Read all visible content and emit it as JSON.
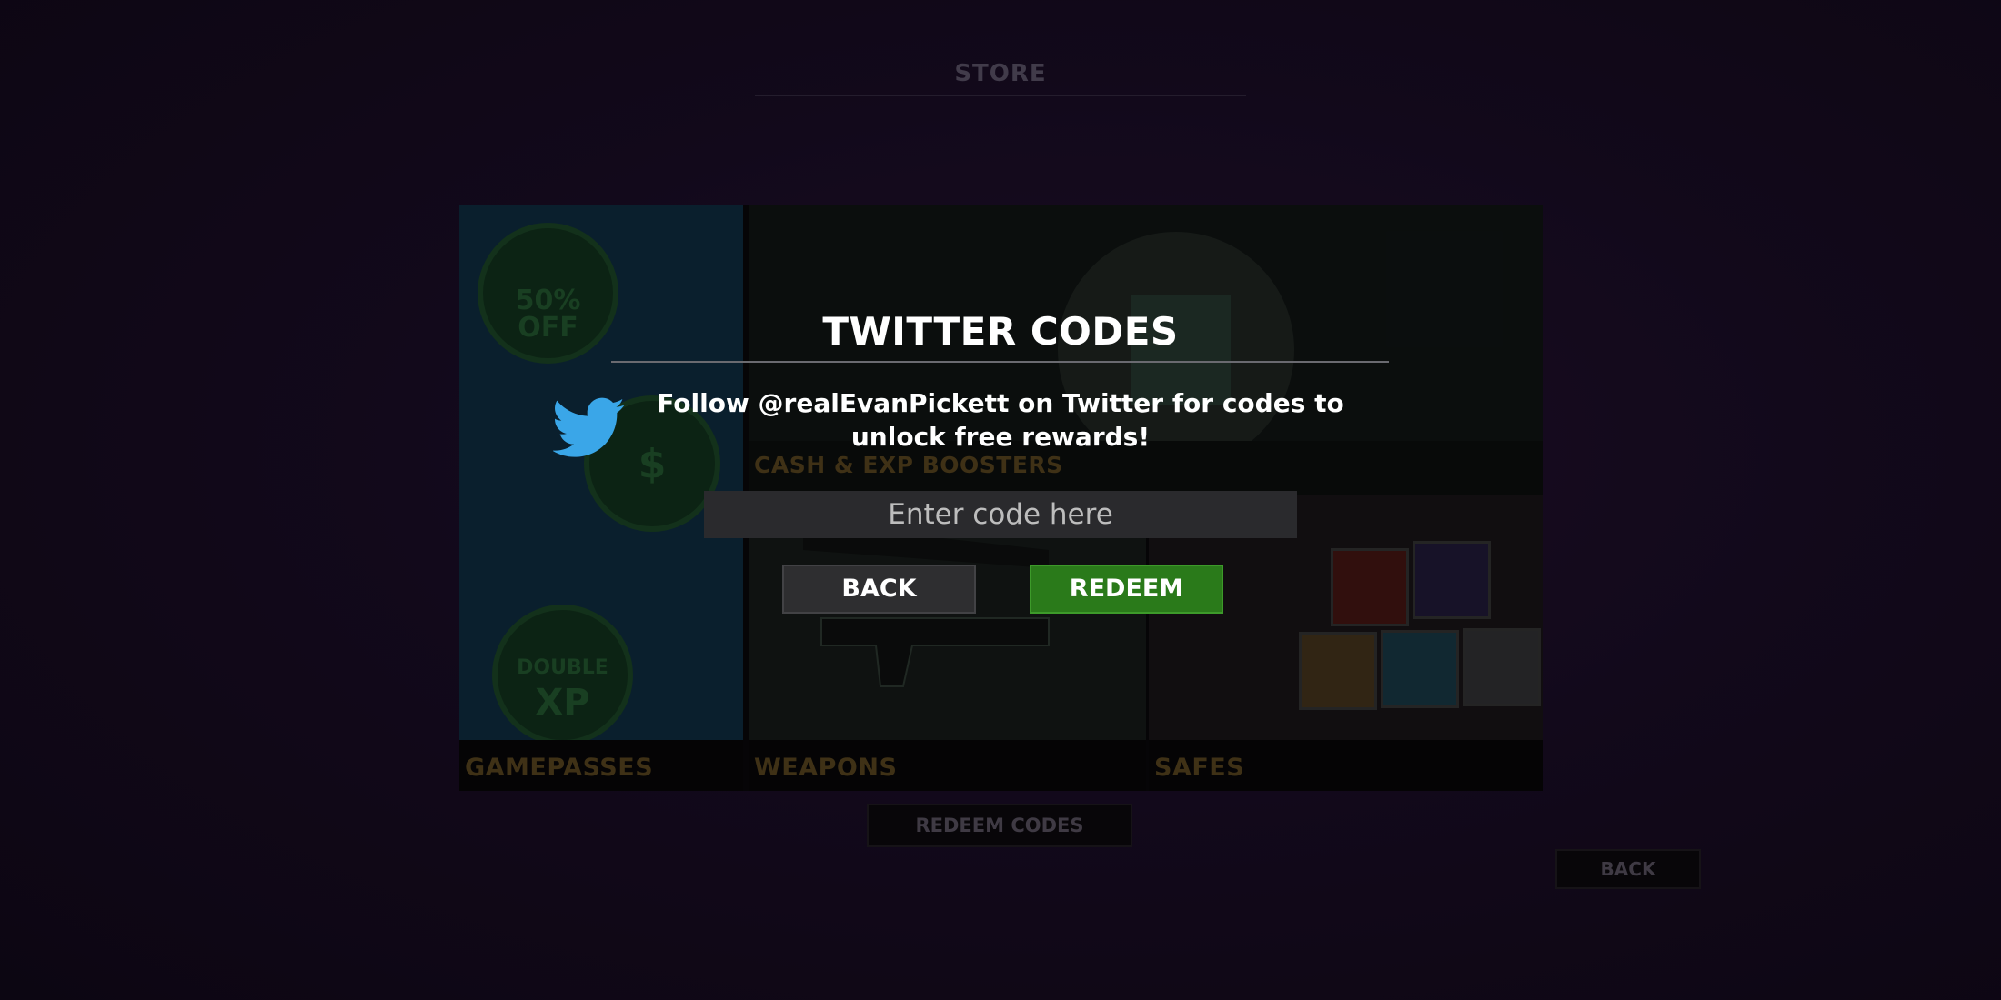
{
  "store": {
    "title": "STORE",
    "cards": {
      "gamepasses": "GAMEPASSES",
      "boosters": "CASH & EXP BOOSTERS",
      "weapons": "WEAPONS",
      "safes": "SAFES"
    },
    "badges": {
      "discount_line1": "50%",
      "discount_line2": "OFF",
      "cash_symbol": "$",
      "double_xp_line1": "DOUBLE",
      "double_xp_line2": "XP"
    },
    "redeem_codes_label": "REDEEM CODES",
    "back_label": "BACK"
  },
  "modal": {
    "title": "TWITTER CODES",
    "description": "Follow @realEvanPickett on Twitter for codes to unlock free rewards!",
    "input_value": "",
    "input_placeholder": "Enter code here",
    "back_label": "BACK",
    "redeem_label": "REDEEM",
    "icon": "twitter-bird-icon"
  },
  "colors": {
    "redeem_green": "#2a7a1a",
    "twitter_blue": "#3aa6e8",
    "label_gold": "#4a3a1a"
  }
}
